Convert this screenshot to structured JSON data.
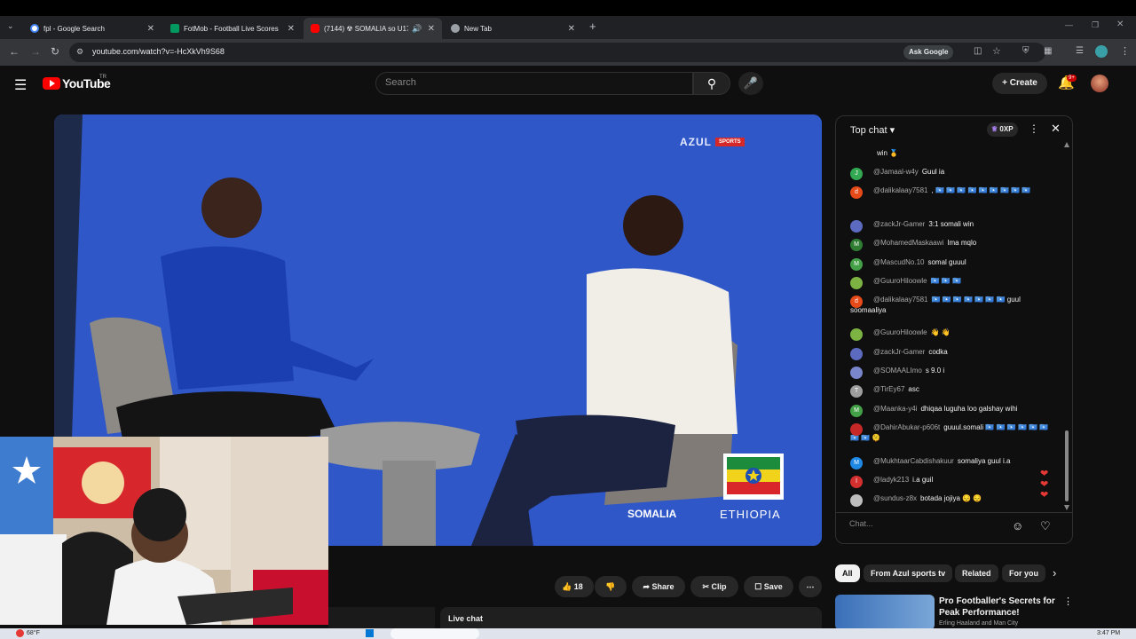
{
  "browser": {
    "tabs": [
      {
        "title": "fpl - Google Search",
        "active": false,
        "icon": "google-icon",
        "color": "#4285f4"
      },
      {
        "title": "FotMob - Football Live Scores",
        "active": false,
        "icon": "fotmob-icon",
        "color": "#00985f"
      },
      {
        "title": "(7144) ☢ SOMALIA so U17",
        "active": true,
        "icon": "youtube-icon",
        "color": "#ff0000"
      },
      {
        "title": "New Tab",
        "active": false,
        "icon": "chrome-icon",
        "color": "#9aa0a6"
      }
    ],
    "url": "youtube.com/watch?v=-HcXkVh9S68",
    "ask_google": "Ask Google"
  },
  "youtube": {
    "logo_text": "YouTube",
    "country_code": "TR",
    "search_placeholder": "Search",
    "create_label": "Create",
    "notif_badge": "9+"
  },
  "video": {
    "brand": "AZUL",
    "brand_sub": "SPORTS",
    "team_right": "ETHIOPIA",
    "team_left": "SOMALIA"
  },
  "actions": {
    "likes": "18",
    "share": "Share",
    "clip": "Clip",
    "save": "Save",
    "live_chat": "Live chat"
  },
  "chat": {
    "header": "Top chat",
    "xp": "0XP",
    "input_placeholder": "Chat...",
    "messages": [
      {
        "name": "",
        "text": "win 🥇",
        "color": "#7b4ba8",
        "initial": ""
      },
      {
        "name": "@Jamaal-w4y",
        "text": "Guul ia",
        "color": "#33a852",
        "initial": "J"
      },
      {
        "name": "@dalikalaay7581",
        "text": ", 🇸🇴 🇸🇴 🇸🇴 🇸🇴 🇸🇴 🇸🇴 🇸🇴 🇸🇴 🇸🇴",
        "color": "#e64a19",
        "initial": "d"
      },
      {
        "name": "@zackJr-Gamer",
        "text": "3:1 somali win",
        "color": "#5c6bc0",
        "initial": ""
      },
      {
        "name": "@MohamedMaskaawi",
        "text": "Ima mqlo",
        "color": "#2e7d32",
        "initial": "M"
      },
      {
        "name": "@MascudNo.10",
        "text": "somal guuul",
        "color": "#43a047",
        "initial": "M"
      },
      {
        "name": "@GuuroHiloowle",
        "text": "🇸🇴 🇸🇴 🇸🇴",
        "color": "#7cb342",
        "initial": ""
      },
      {
        "name": "@dalikalaay7581",
        "text": "🇸🇴 🇸🇴 🇸🇴 🇸🇴 🇸🇴 🇸🇴 🇸🇴 guul soomaaliya",
        "color": "#e64a19",
        "initial": "d"
      },
      {
        "name": "@GuuroHiloowle",
        "text": "👋 👋",
        "color": "#7cb342",
        "initial": ""
      },
      {
        "name": "@zackJr-Gamer",
        "text": "codka",
        "color": "#5c6bc0",
        "initial": ""
      },
      {
        "name": "@SOMAALImo",
        "text": "s 9.0 i",
        "color": "#7986cb",
        "initial": ""
      },
      {
        "name": "@TirEy67",
        "text": "asc",
        "color": "#9e9e9e",
        "initial": "T"
      },
      {
        "name": "@Maanka-y4i",
        "text": "dhiqaa luguha loo galshay wihi",
        "color": "#43a047",
        "initial": "M"
      },
      {
        "name": "@DahirAbukar-p606t",
        "text": "guuul.somali 🇸🇴 🇸🇴 🇸🇴 🇸🇴 🇸🇴 🇸🇴 🇸🇴 🇸🇴 🫠",
        "color": "#c62828",
        "initial": ""
      },
      {
        "name": "@MukhtaarCabdishakuur",
        "text": "somaliya guul i.a",
        "color": "#1e88e5",
        "initial": "M"
      },
      {
        "name": "@ladyk213",
        "text": "i.a guil",
        "color": "#d32f2f",
        "initial": "l"
      },
      {
        "name": "@sundus-z8x",
        "text": "botada jojiya 😔 😔",
        "color": "#bdbdbd",
        "initial": ""
      }
    ]
  },
  "related": {
    "tags": [
      "All",
      "From Azul sports tv",
      "Related",
      "For you"
    ],
    "video_title": "Pro Footballer's Secrets for Peak Performance!",
    "video_channel": "Erling Haaland and Man City"
  },
  "taskbar": {
    "temp": "68°F",
    "time": "3:47 PM"
  }
}
